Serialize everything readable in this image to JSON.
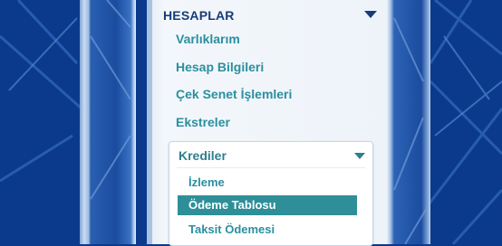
{
  "menu": {
    "title": "HESAPLAR",
    "items": [
      {
        "label": "Varlıklarım"
      },
      {
        "label": "Hesap Bilgileri"
      },
      {
        "label": "Çek Senet İşlemleri"
      },
      {
        "label": "Ekstreler"
      }
    ],
    "submenu": {
      "title": "Krediler",
      "items": [
        {
          "label": "İzleme",
          "active": false
        },
        {
          "label": "Ödeme Tablosu",
          "active": true
        },
        {
          "label": "Taksit Ödemesi",
          "active": false
        }
      ]
    }
  },
  "colors": {
    "background": "#0b3a8c",
    "header_text": "#173c78",
    "link": "#2b8fa0",
    "active_bg": "#2e8f98"
  }
}
